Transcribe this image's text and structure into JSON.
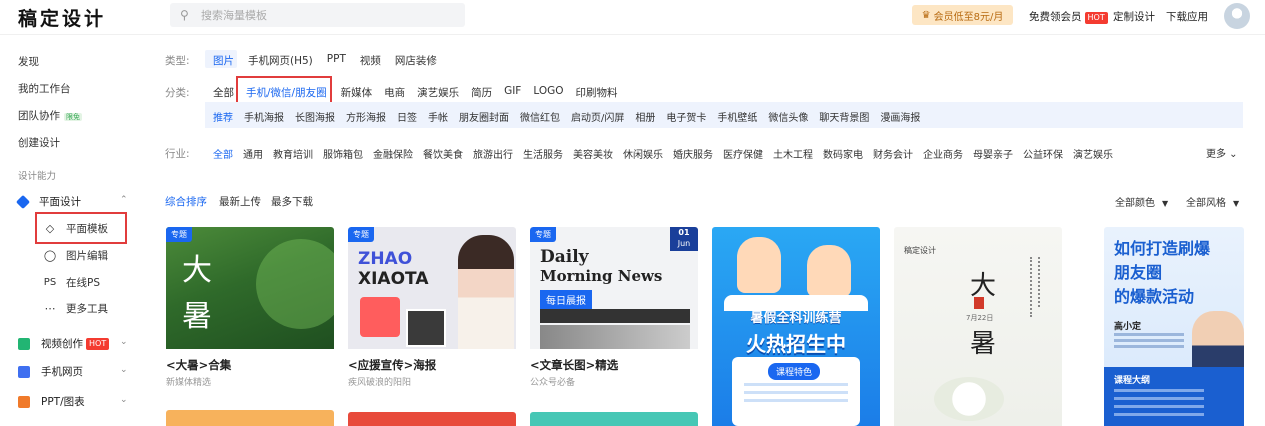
{
  "header": {
    "logo": "稿定设计",
    "search_placeholder": "搜索海量模板",
    "vip_label": "会员低至8元/月",
    "free_vip": "免费领会员",
    "hot_badge": "HOT",
    "custom_design": "定制设计",
    "download_app": "下载应用"
  },
  "sidebar": {
    "discover": "发现",
    "workspace": "我的工作台",
    "team": "团队协作",
    "team_badge": "限免",
    "create": "创建设计",
    "section_label": "设计能力",
    "graphic_design": "平面设计",
    "graphic_items": [
      {
        "label": "平面模板",
        "icon": "layers-icon"
      },
      {
        "label": "图片编辑",
        "icon": "edit-icon"
      },
      {
        "label": "在线PS",
        "icon": "ps-icon"
      },
      {
        "label": "更多工具",
        "icon": "more-icon"
      }
    ],
    "video_creation": "视频创作",
    "video_badge": "HOT",
    "h5": "手机网页",
    "ppt": "PPT/图表"
  },
  "filters": {
    "type_label": "类型:",
    "types": [
      "图片",
      "手机网页(H5)",
      "PPT",
      "视频",
      "网店装修"
    ],
    "category_label": "分类:",
    "categories": [
      "全部",
      "手机/微信/朋友圈",
      "新媒体",
      "电商",
      "演艺娱乐",
      "简历",
      "GIF",
      "LOGO",
      "印刷物料"
    ],
    "subcategories": [
      "推荐",
      "手机海报",
      "长图海报",
      "方形海报",
      "日签",
      "手帐",
      "朋友圈封面",
      "微信红包",
      "启动页/闪屏",
      "相册",
      "电子贺卡",
      "手机壁纸",
      "微信头像",
      "聊天背景图",
      "漫画海报"
    ],
    "industry_label": "行业:",
    "industries": [
      "全部",
      "通用",
      "教育培训",
      "服饰箱包",
      "金融保险",
      "餐饮美食",
      "旅游出行",
      "生活服务",
      "美容美妆",
      "休闲娱乐",
      "婚庆服务",
      "医疗保健",
      "土木工程",
      "数码家电",
      "财务会计",
      "企业商务",
      "母婴亲子",
      "公益环保",
      "演艺娱乐"
    ],
    "more": "更多"
  },
  "sort": {
    "options": [
      "综合排序",
      "最新上传",
      "最多下载"
    ],
    "color": "全部颜色",
    "style": "全部风格"
  },
  "cards": [
    {
      "tag": "专题",
      "title": "<大暑>合集",
      "sub": "新媒体精选",
      "big1": "大",
      "big2": "暑"
    },
    {
      "tag": "专题",
      "title": "<应援宣传>海报",
      "sub": "疾风破浪的阳阳",
      "line1": "ZHAO",
      "line2": "XIAOTA"
    },
    {
      "tag": "专题",
      "title": "<文章长图>精选",
      "sub": "公众号必备",
      "line1": "Daily",
      "line2": "Morning News",
      "badge": "每日晨报",
      "date_day": "01",
      "date_month": "Jun"
    },
    {
      "line1": "暑假全科训练营",
      "line2": "火热招生中",
      "feature": "课程特色"
    },
    {
      "brand": "稿定设计",
      "big1": "大",
      "big2": "暑",
      "date": "7月22日"
    },
    {
      "line1": "如何打造刷爆",
      "line2": "朋友圈",
      "line3": "的爆款活动",
      "name": "高小定",
      "outline": "课程大纲"
    }
  ]
}
